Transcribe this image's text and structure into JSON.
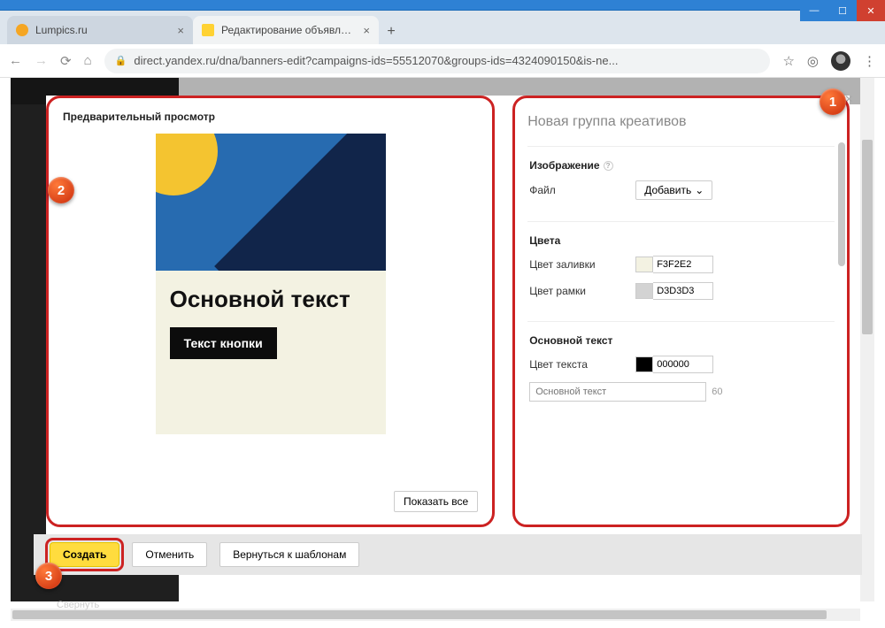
{
  "window": {
    "tabs": [
      {
        "title": "Lumpics.ru"
      },
      {
        "title": "Редактирование объявлений"
      }
    ],
    "url": "direct.yandex.ru/dna/banners-edit?campaigns-ids=55512070&groups-ids=4324090150&is-ne..."
  },
  "modal": {
    "preview_title": "Предварительный просмотр",
    "banner": {
      "main_text": "Основной текст",
      "button_text": "Текст кнопки"
    },
    "show_all": "Показать все",
    "close_x": "×"
  },
  "settings": {
    "title": "Новая группа креативов",
    "image": {
      "heading": "Изображение",
      "file_label": "Файл",
      "add_label": "Добавить"
    },
    "colors": {
      "heading": "Цвета",
      "fill_label": "Цвет заливки",
      "fill_value": "F3F2E2",
      "border_label": "Цвет рамки",
      "border_value": "D3D3D3"
    },
    "main_text": {
      "heading": "Основной текст",
      "color_label": "Цвет текста",
      "color_value": "000000",
      "placeholder": "Основной текст",
      "limit": "60"
    }
  },
  "actions": {
    "create": "Создать",
    "cancel": "Отменить",
    "back": "Вернуться к шаблонам"
  },
  "collapse_hint": "Свернуть",
  "swatches": {
    "fill": "#F3F2E2",
    "border": "#D3D3D3",
    "text": "#000000"
  },
  "badges": {
    "one": "1",
    "two": "2",
    "three": "3"
  }
}
